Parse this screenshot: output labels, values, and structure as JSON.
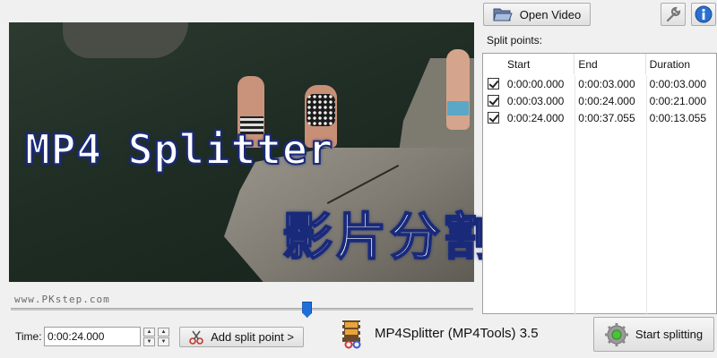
{
  "video": {
    "overlay_title": "MP4 Splitter",
    "overlay_subtitle": "影片分割軟體",
    "watermark": "www.PKstep.com"
  },
  "seek": {
    "position_fraction": 0.64
  },
  "toolbar": {
    "open_video_label": "Open Video",
    "tools_icon": "wrench-icon",
    "info_icon": "info-icon"
  },
  "split_points": {
    "label": "Split points:",
    "columns": [
      "Start",
      "End",
      "Duration"
    ],
    "rows": [
      {
        "checked": true,
        "start": "0:00:00.000",
        "end": "0:00:03.000",
        "duration": "0:00:03.000"
      },
      {
        "checked": true,
        "start": "0:00:03.000",
        "end": "0:00:24.000",
        "duration": "0:00:21.000"
      },
      {
        "checked": true,
        "start": "0:00:24.000",
        "end": "0:00:37.055",
        "duration": "0:00:13.055"
      }
    ]
  },
  "time": {
    "label": "Time:",
    "value": "0:00:24.000"
  },
  "add_split_label": "Add split point >",
  "app_name": "MP4Splitter (MP4Tools) 3.5",
  "start_splitting_label": "Start splitting",
  "colors": {
    "accent": "#1e6fd9",
    "overlay_stroke": "#1a2a7a"
  }
}
